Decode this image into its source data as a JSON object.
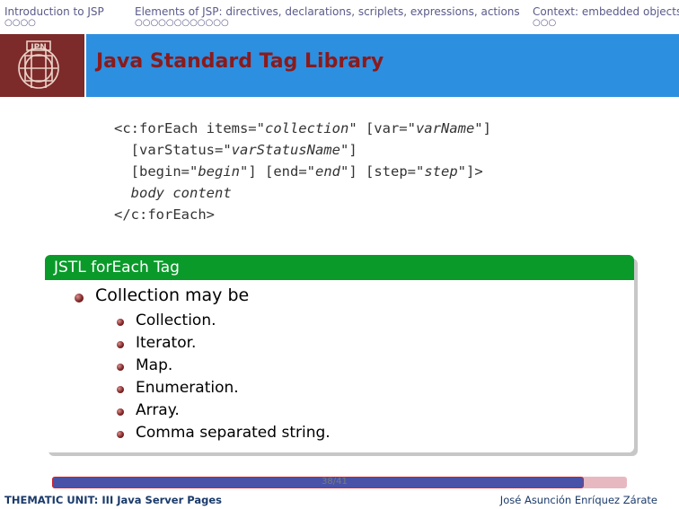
{
  "nav": {
    "sections": [
      {
        "label": "Introduction to JSP",
        "dots": "○○○○"
      },
      {
        "label": "Elements of JSP: directives, declarations, scriplets, expressions, actions",
        "dots": "○○○○○○○○○○○○"
      },
      {
        "label": "Context: embedded objects",
        "dots": "○○○"
      }
    ]
  },
  "header": {
    "title": "Java Standard Tag Library"
  },
  "code": {
    "l1a": "<c:forEach items=\"",
    "l1b": "collection",
    "l1c": "\" [var=\"",
    "l1d": "varName",
    "l1e": "\"]",
    "l2a": "  [varStatus=\"",
    "l2b": "varStatusName",
    "l2c": "\"]",
    "l3a": "  [begin=\"",
    "l3b": "begin",
    "l3c": "\"] [end=\"",
    "l3d": "end",
    "l3e": "\"] [step=\"",
    "l3f": "step",
    "l3g": "\"]>",
    "l4": "  body content",
    "l5": "</c:forEach>"
  },
  "block": {
    "title": "JSTL forEach Tag",
    "item": "Collection may be",
    "subitems": [
      "Collection.",
      "Iterator.",
      "Map.",
      "Enumeration.",
      "Array.",
      "Comma separated string."
    ]
  },
  "footer": {
    "left": "THEMATIC UNIT: III Java Server Pages",
    "right": "José Asunción Enríquez Zárate",
    "page": "38/41",
    "progress": 0.925
  }
}
